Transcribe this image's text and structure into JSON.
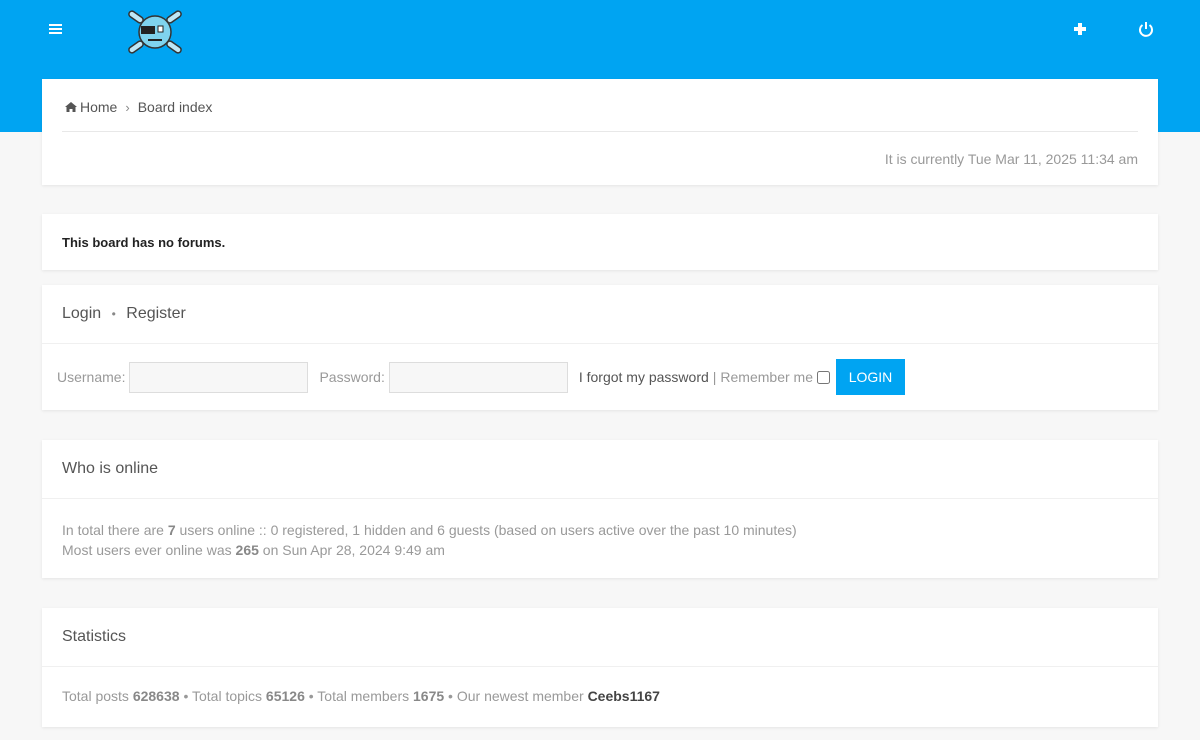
{
  "header": {
    "menu_icon": "hamburger-icon",
    "logo_icon": "skull-crossbones-logo",
    "new_icon": "plus-icon",
    "power_icon": "power-icon",
    "accent_color": "#00a4f2"
  },
  "breadcrumb": {
    "home": "Home",
    "board_index": "Board index"
  },
  "current_time": "It is currently Tue Mar 11, 2025 11:34 am",
  "no_forums": "This board has no forums.",
  "login": {
    "login_label": "Login",
    "register_label": "Register",
    "username_label": "Username:",
    "username_value": "",
    "password_label": "Password:",
    "password_value": "",
    "forgot": "I forgot my password",
    "remember": "Remember me",
    "button": "LOGIN"
  },
  "online": {
    "title": "Who is online",
    "prefix": "In total there are",
    "count": "7",
    "details": "users online :: 0 registered, 1 hidden and 6 guests (based on users active over the past 10 minutes)",
    "most_prefix": "Most users ever online was",
    "most_count": "265",
    "most_suffix": "on Sun Apr 28, 2024 9:49 am"
  },
  "stats": {
    "title": "Statistics",
    "posts_label": "Total posts",
    "posts": "628638",
    "topics_label": "Total topics",
    "topics": "65126",
    "members_label": "Total members",
    "members": "1675",
    "newest_label": "Our newest member",
    "newest": "Ceebs1167"
  }
}
